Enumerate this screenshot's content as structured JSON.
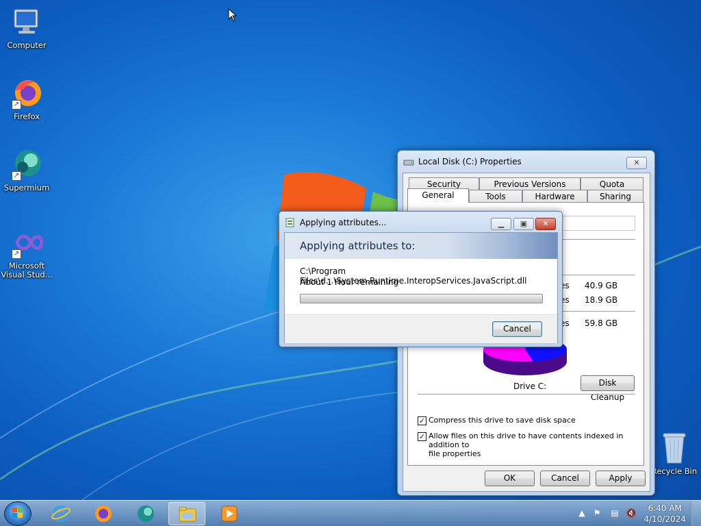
{
  "desktop": {
    "icons": [
      {
        "label": "Computer",
        "icon": "computer-icon"
      },
      {
        "label": "Firefox",
        "icon": "firefox-icon"
      },
      {
        "label": "Supermium",
        "icon": "supermium-icon"
      },
      {
        "label_line1": "Microsoft",
        "label_line2": "Visual Stud...",
        "icon": "visual-studio-icon"
      },
      {
        "label": "Recycle Bin",
        "icon": "recycle-bin-icon"
      }
    ]
  },
  "properties_window": {
    "title": "Local Disk (C:) Properties",
    "tabs_row1": [
      "Security",
      "Previous Versions",
      "Quota"
    ],
    "tabs_row2": [
      "General",
      "Tools",
      "Hardware",
      "Sharing"
    ],
    "used_space": "40.9 GB",
    "free_space": "18.9 GB",
    "capacity": "59.8 GB",
    "drive_label": "Drive C:",
    "disk_cleanup": "Disk Cleanup",
    "compress_label": "Compress this drive to save disk space",
    "compress_checked": true,
    "index_label_line1": "Allow files on this drive to have contents indexed in addition to",
    "index_label_line2": "file properties",
    "index_checked": true,
    "ok": "OK",
    "cancel": "Cancel",
    "apply": "Apply",
    "pie_colors": {
      "used": "#1010ff",
      "free": "#ff00ff"
    },
    "label_partials": [
      "es",
      "es",
      "es"
    ]
  },
  "progress_dialog": {
    "title": "Applying attributes...",
    "heading": "Applying attributes to:",
    "path": "C:\\Program Files\\d...\\System.Runtime.InteropServices.JavaScript.dll",
    "time_remaining": "About 1 Hour remaining",
    "progress_fraction": 0.0,
    "cancel": "Cancel"
  },
  "taskbar": {
    "items": [
      "internet-explorer-icon",
      "firefox-icon",
      "supermium-icon",
      "file-explorer-icon",
      "media-player-icon"
    ],
    "active_item": "file-explorer-icon",
    "time": "6:40 AM",
    "date": "4/10/2024"
  }
}
